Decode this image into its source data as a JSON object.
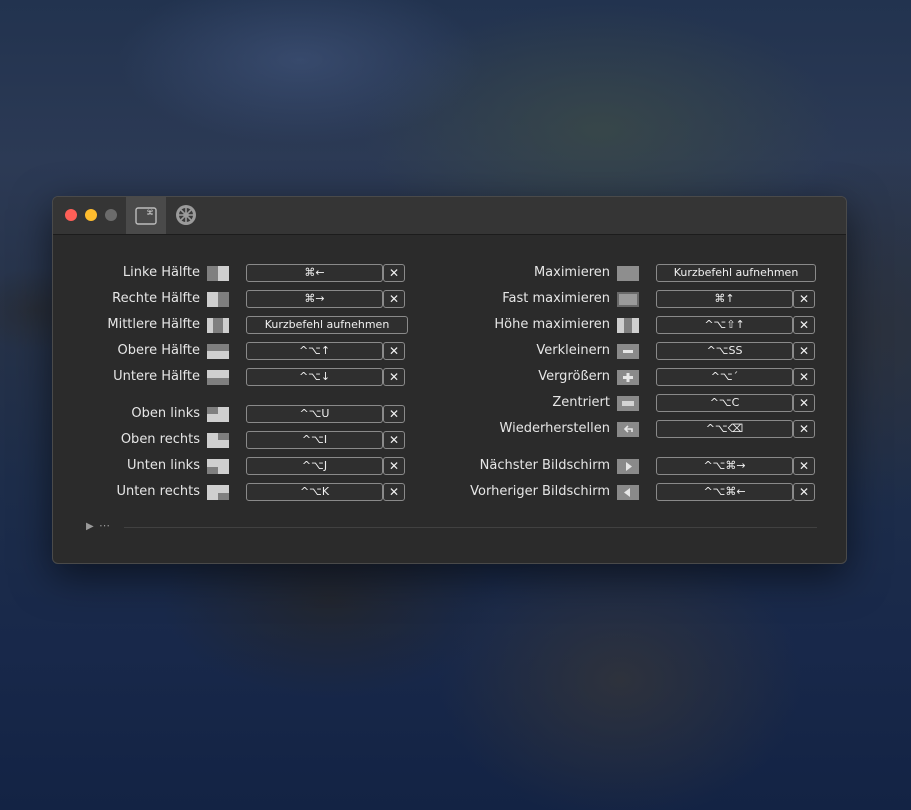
{
  "window": {
    "left_rows": [
      {
        "id": "linke-haelfte",
        "label": "Linke Hälfte",
        "icon": "left-half-icon",
        "shortcut": "⌘←",
        "clearable": true
      },
      {
        "id": "rechte-haelfte",
        "label": "Rechte Hälfte",
        "icon": "right-half-icon",
        "shortcut": "⌘→",
        "clearable": true
      },
      {
        "id": "mittlere-haelfte",
        "label": "Mittlere Hälfte",
        "icon": "center-half-icon",
        "shortcut": "Kurzbefehl aufnehmen",
        "clearable": false
      },
      {
        "id": "obere-haelfte",
        "label": "Obere Hälfte",
        "icon": "top-half-icon",
        "shortcut": "^⌥↑",
        "clearable": true
      },
      {
        "id": "untere-haelfte",
        "label": "Untere Hälfte",
        "icon": "bottom-half-icon",
        "shortcut": "^⌥↓",
        "clearable": true
      },
      {
        "id": "oben-links",
        "label": "Oben links",
        "icon": "top-left-icon",
        "shortcut": "^⌥U",
        "clearable": true
      },
      {
        "id": "oben-rechts",
        "label": "Oben rechts",
        "icon": "top-right-icon",
        "shortcut": "^⌥I",
        "clearable": true
      },
      {
        "id": "unten-links",
        "label": "Unten links",
        "icon": "bottom-left-icon",
        "shortcut": "^⌥J",
        "clearable": true
      },
      {
        "id": "unten-rechts",
        "label": "Unten rechts",
        "icon": "bottom-right-icon",
        "shortcut": "^⌥K",
        "clearable": true
      }
    ],
    "right_rows": [
      {
        "id": "maximieren",
        "label": "Maximieren",
        "icon": "maximize-icon",
        "shortcut": "Kurzbefehl aufnehmen",
        "clearable": false
      },
      {
        "id": "fast-maximieren",
        "label": "Fast maximieren",
        "icon": "almost-maximize-icon",
        "shortcut": "⌘↑",
        "clearable": true
      },
      {
        "id": "hoehe-maximieren",
        "label": "Höhe maximieren",
        "icon": "maximize-height-icon",
        "shortcut": "^⌥⇧↑",
        "clearable": true
      },
      {
        "id": "verkleinern",
        "label": "Verkleinern",
        "icon": "minus-icon",
        "shortcut": "^⌥SS",
        "clearable": true
      },
      {
        "id": "vergroessern",
        "label": "Vergrößern",
        "icon": "plus-icon",
        "shortcut": "^⌥´",
        "clearable": true
      },
      {
        "id": "zentriert",
        "label": "Zentriert",
        "icon": "center-icon",
        "shortcut": "^⌥C",
        "clearable": true
      },
      {
        "id": "wiederherstellen",
        "label": "Wiederherstellen",
        "icon": "restore-icon",
        "shortcut": "^⌥⌫",
        "clearable": true
      },
      {
        "id": "naechster-bildschirm",
        "label": "Nächster Bildschirm",
        "icon": "next-display-icon",
        "shortcut": "^⌥⌘→",
        "clearable": true
      },
      {
        "id": "vorheriger-bildschirm",
        "label": "Vorheriger Bildschirm",
        "icon": "previous-display-icon",
        "shortcut": "^⌥⌘←",
        "clearable": true
      }
    ],
    "clear_glyph": "✕",
    "footer_dots": "⋯",
    "toolbar": {
      "shortcuts_tab_icon": "command-key-icon",
      "settings_icon": "gear-icon"
    }
  }
}
